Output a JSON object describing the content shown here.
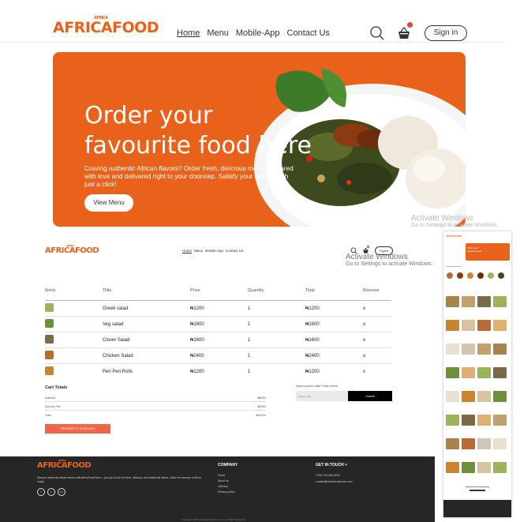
{
  "brand": {
    "logo": "AFRICAFOOD",
    "logo_sub": "AFRICA",
    "accent": "#e8621c"
  },
  "nav": {
    "home": "Home",
    "menu": "Menu",
    "mobile_app": "Mobile-App",
    "contact": "Contact Us",
    "sign_in": "Sign in"
  },
  "hero": {
    "title": "Order your favourite food here",
    "description": "Craving authentic African flavors? Order fresh, delicious meals prepared with love and delivered right to your doorstep. Satisfy your hunger with just a click!",
    "button": "View Menu"
  },
  "activate": {
    "title": "Activate Windows",
    "sub": "Go to Settings to activate Windows."
  },
  "cart": {
    "nav_sign_in": "Signin",
    "columns": [
      "Items",
      "Tiltle",
      "Price",
      "Quantity",
      "Total",
      "Remove"
    ],
    "rows": [
      {
        "title": "Greek salad",
        "price": "₦1200",
        "quantity": "1",
        "total": "₦1200",
        "remove": "x",
        "thumb_color": "#9bb35a"
      },
      {
        "title": "Veg salad",
        "price": "₦1800",
        "quantity": "1",
        "total": "₦1800",
        "remove": "x",
        "thumb_color": "#6f8f3e"
      },
      {
        "title": "Clover Salad",
        "price": "₦1600",
        "quantity": "1",
        "total": "₦1600",
        "remove": "x",
        "thumb_color": "#7a6a48"
      },
      {
        "title": "Chicken Salad",
        "price": "₦2400",
        "quantity": "1",
        "total": "₦2400",
        "remove": "x",
        "thumb_color": "#b86b35"
      },
      {
        "title": "Peri Peri Rolls",
        "price": "₦1200",
        "quantity": "1",
        "total": "₦1200",
        "remove": "x",
        "thumb_color": "#c9852e"
      }
    ],
    "totals_title": "Cart Totals",
    "subtotal_label": "Subtotal",
    "subtotal_value": "₦8200",
    "delivery_label": "Delivery Fee",
    "delivery_value": "₦2000",
    "total_label": "Total",
    "total_value": "₦10200",
    "checkout": "PROCEED TO CHECKOUT",
    "promo_label": "Have a promo code? Enter it here!",
    "promo_placeholder": "promo code",
    "promo_button": "Submit"
  },
  "footer": {
    "description": "Discover authentic African flavors with AfricaFoodHome – your go-to hub for fresh, delicious, and traditional dishes. Taste the essence of Africa today!",
    "company_title": "COMPANY",
    "company_links": [
      "Home",
      "About us",
      "Delivery",
      "Privacy policy"
    ],
    "contact_title": "GET IN TOUCH",
    "phone": "+234-703-265-4021",
    "email": "contact@africafoodhome.com",
    "social": [
      "f",
      "t",
      "in"
    ],
    "copyright": "Copyright 2025 © AfricaFoodHome.com - All Right Reserved."
  },
  "mobile": {
    "hero_title": "Order your favourite food"
  }
}
